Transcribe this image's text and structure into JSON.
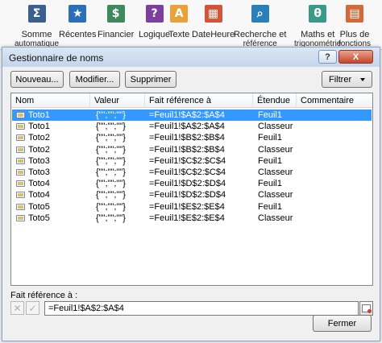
{
  "ribbon": {
    "items": [
      {
        "label": "Somme",
        "sub": "automatique",
        "icon": "sigma-icon",
        "glyph": "Σ",
        "color": "#3b5f8f"
      },
      {
        "label": "Récentes",
        "icon": "star-book-icon",
        "glyph": "★",
        "color": "#2a6fb8"
      },
      {
        "label": "Financier",
        "icon": "finance-book-icon",
        "glyph": "$",
        "color": "#3e8a5c"
      },
      {
        "label": "Logique",
        "icon": "logic-book-icon",
        "glyph": "?",
        "color": "#7b3fa0"
      },
      {
        "label": "Texte",
        "icon": "text-book-icon",
        "glyph": "A",
        "color": "#e7a33a"
      },
      {
        "label": "DateHeure",
        "icon": "calendar-book-icon",
        "glyph": "▦",
        "color": "#d2553a"
      },
      {
        "label": "Recherche et",
        "sub": "référence",
        "icon": "search-book-icon",
        "glyph": "⌕",
        "color": "#2b7fb8"
      },
      {
        "label": "Maths et",
        "sub": "trigonométrie",
        "icon": "math-book-icon",
        "glyph": "θ",
        "color": "#3a9a8a"
      },
      {
        "label": "Plus de",
        "sub": "fonctions",
        "icon": "more-functions-icon",
        "glyph": "▤",
        "color": "#d46a3a"
      }
    ]
  },
  "dialog": {
    "title": "Gestionnaire de noms",
    "help": "?",
    "close": "X",
    "toolbar": {
      "new_label": "Nouveau...",
      "edit_label": "Modifier...",
      "delete_label": "Supprimer",
      "filter_label": "Filtrer"
    },
    "columns": [
      "Nom",
      "Valeur",
      "Fait référence à",
      "Étendue",
      "Commentaire"
    ],
    "rows": [
      {
        "name": "Toto1",
        "value": "{\"\";\"\";\"\"}",
        "ref": "=Feuil1!$A$2:$A$4",
        "scope": "Feuil1",
        "comment": ""
      },
      {
        "name": "Toto1",
        "value": "{\"\";\"\";\"\"}",
        "ref": "=Feuil1!$A$2:$A$4",
        "scope": "Classeur",
        "comment": ""
      },
      {
        "name": "Toto2",
        "value": "{\"\";\"\";\"\"}",
        "ref": "=Feuil1!$B$2:$B$4",
        "scope": "Feuil1",
        "comment": ""
      },
      {
        "name": "Toto2",
        "value": "{\"\";\"\";\"\"}",
        "ref": "=Feuil1!$B$2:$B$4",
        "scope": "Classeur",
        "comment": ""
      },
      {
        "name": "Toto3",
        "value": "{\"\";\"\";\"\"}",
        "ref": "=Feuil1!$C$2:$C$4",
        "scope": "Feuil1",
        "comment": ""
      },
      {
        "name": "Toto3",
        "value": "{\"\";\"\";\"\"}",
        "ref": "=Feuil1!$C$2:$C$4",
        "scope": "Classeur",
        "comment": ""
      },
      {
        "name": "Toto4",
        "value": "{\"\";\"\";\"\"}",
        "ref": "=Feuil1!$D$2:$D$4",
        "scope": "Feuil1",
        "comment": ""
      },
      {
        "name": "Toto4",
        "value": "{\"\";\"\";\"\"}",
        "ref": "=Feuil1!$D$2:$D$4",
        "scope": "Classeur",
        "comment": ""
      },
      {
        "name": "Toto5",
        "value": "{\"\";\"\";\"\"}",
        "ref": "=Feuil1!$E$2:$E$4",
        "scope": "Feuil1",
        "comment": ""
      },
      {
        "name": "Toto5",
        "value": "{\"\";\"\";\"\"}",
        "ref": "=Feuil1!$E$2:$E$4",
        "scope": "Classeur",
        "comment": ""
      }
    ],
    "selected_row": 0,
    "ref_label": "Fait référence à :",
    "ref_value": "=Feuil1!$A$2:$A$4",
    "cancel_glyph": "✕",
    "confirm_glyph": "✓",
    "close_label": "Fermer",
    "selection_color": "#3399ff"
  }
}
